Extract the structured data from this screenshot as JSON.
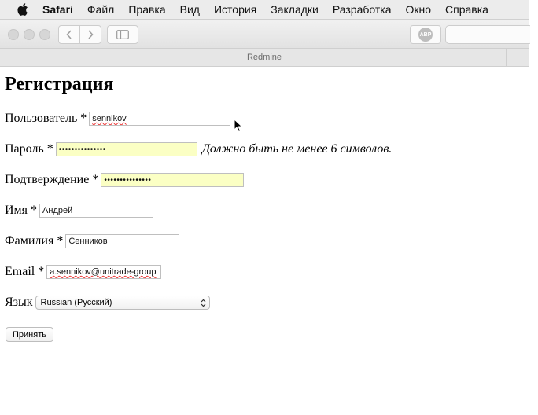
{
  "menubar": {
    "app": "Safari",
    "items": [
      "Файл",
      "Правка",
      "Вид",
      "История",
      "Закладки",
      "Разработка",
      "Окно",
      "Справка"
    ]
  },
  "toolbar": {
    "adblock_label": "ABP"
  },
  "tab": {
    "title": "Redmine"
  },
  "page": {
    "title": "Регистрация",
    "fields": {
      "login": {
        "label": "Пользователь *",
        "value": "sennikov"
      },
      "password": {
        "label": "Пароль *",
        "value": "•••••••••••••••",
        "hint": "Должно быть не менее 6 символов."
      },
      "confirm": {
        "label": "Подтверждение *",
        "value": "•••••••••••••••"
      },
      "firstname": {
        "label": "Имя *",
        "value": "Андрей"
      },
      "lastname": {
        "label": "Фамилия *",
        "value": "Сенников"
      },
      "email": {
        "label": "Email *",
        "value": "a.sennikov@unitrade-group"
      },
      "language": {
        "label": "Язык",
        "value": "Russian (Русский)"
      }
    },
    "submit_label": "Принять"
  },
  "colors": {
    "autofill_yellow": "#fbffc4",
    "menubar_bg": "#ececec"
  }
}
